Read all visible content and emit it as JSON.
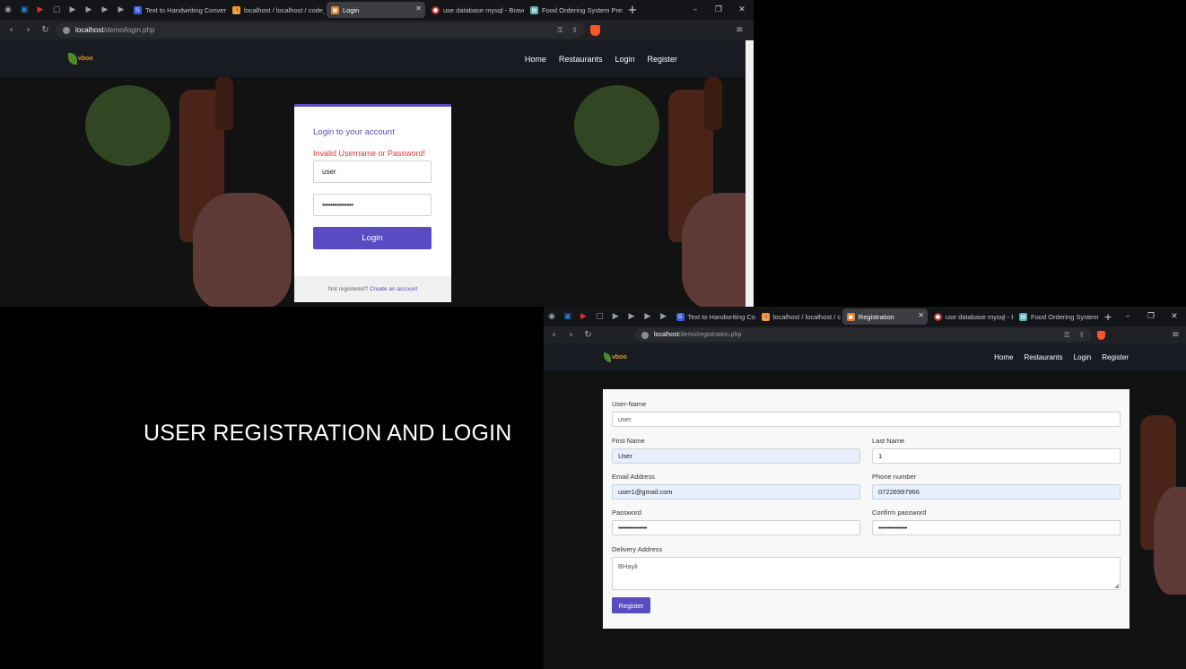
{
  "slide_title": "USER REGISTRATION AND LOGIN",
  "login_window": {
    "tabs": [
      {
        "label": "Text to Handwriting Converter",
        "icon": "g-logo-icon"
      },
      {
        "label": "localhost / localhost / code_c",
        "icon": "phpmyadmin-icon"
      },
      {
        "label": "Login",
        "icon": "page-icon",
        "active": true,
        "close": "✕"
      },
      {
        "label": "use database mysql - Brave Se",
        "icon": "brave-search-icon"
      },
      {
        "label": "Food Ordering System Presen",
        "icon": "slides-icon"
      }
    ],
    "new_tab": "+",
    "url_host": "localhost",
    "url_path": "/demo/login.php",
    "logo_text": "vboo",
    "nav": [
      "Home",
      "Restaurants",
      "Login",
      "Register"
    ],
    "card": {
      "heading": "Login to your account",
      "error": "Invalid Username or Password!",
      "username_value": "user",
      "password_value": "•••••••••••••••",
      "login_button": "Login",
      "footer_text": "Not registered?",
      "footer_link": "Create an account"
    }
  },
  "registration_window": {
    "tabs": [
      {
        "label": "Text to Handwriting Converter",
        "icon": "g-logo-icon"
      },
      {
        "label": "localhost / localhost / code_c",
        "icon": "phpmyadmin-icon"
      },
      {
        "label": "Registration",
        "icon": "page-icon",
        "active": true,
        "close": "✕"
      },
      {
        "label": "use database mysql - Brave Se",
        "icon": "brave-search-icon"
      },
      {
        "label": "Food Ordering System Presen",
        "icon": "slides-icon"
      }
    ],
    "new_tab": "+",
    "url_host": "localhost",
    "url_path": "/demo/registration.php",
    "logo_text": "vboo",
    "nav": [
      "Home",
      "Restaurants",
      "Login",
      "Register"
    ],
    "form": {
      "username_label": "User-Name",
      "username_value": "user",
      "first_name_label": "First Name",
      "first_name_value": "User",
      "last_name_label": "Last Name",
      "last_name_value": "1",
      "email_label": "Email Address",
      "email_value": "user1@gmail.com",
      "phone_label": "Phone number",
      "phone_value": "07226997966",
      "password_label": "Password",
      "password_value": "•••••••••••••••",
      "confirm_label": "Confirm password",
      "confirm_value": "•••••••••••••••",
      "address_label": "Delivery Address",
      "address_value": "BHayli",
      "register_button": "Register"
    }
  },
  "colors": {
    "accent": "#5a4bc2",
    "error": "#e53935",
    "heading": "#5a4bc2",
    "autofill": "#e8f0fe"
  }
}
